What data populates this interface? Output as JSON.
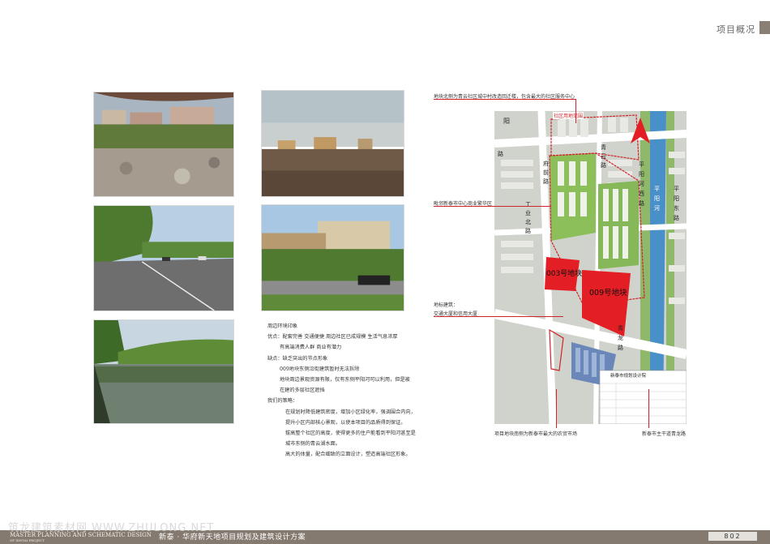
{
  "header": {
    "label": "项目概况"
  },
  "photos": [
    {
      "name": "photo-construction-site"
    },
    {
      "name": "photo-vacant-lot"
    },
    {
      "name": "photo-tree-lined-road"
    },
    {
      "name": "photo-commercial-street"
    },
    {
      "name": "photo-canal"
    }
  ],
  "notes": {
    "title": "周边环境印象",
    "lines": [
      "优点：配套完善  交通便捷  周边社区已成规模  生活气息浓厚",
      "有高端消费人群    商业有潜力",
      "缺点：缺乏突出的节点形象",
      "009地块东侧沿街建筑暂时无法拆除",
      "地块周边景观资源有限，仅有东侧平阳河可以利用，但是被",
      "在建的多层社区遮挡",
      "我们的策略：",
      "在规划时降低建筑密度，增加小区绿化率，强调围合内向，",
      "提升小区内部核心景观，以使本项目的品质得到保证。",
      "拔高整个社区的高度，使得更多的住户能看到平阳河甚至是",
      "城市东侧的青云湖水面。",
      "高大的体量，配合细致的立面设计，塑造高端社区形象。"
    ]
  },
  "map": {
    "callouts": {
      "north": "地块北侧为青云社区城中村改造回迁楼，包含最大的社区服务中心",
      "west": "毗邻新泰市中心商业繁华区",
      "landmark_title": "地标建筑：",
      "landmark_value": "交通大厦和信用大厦",
      "south": "项目地块南侧为新泰市最大的农贸市场",
      "southeast": "新泰市主干道青龙路"
    },
    "plots": {
      "plot_003": "003号地块",
      "plot_009": "009号地块"
    },
    "plot_label_top": "社区用地范围",
    "roads": {
      "qingyun_road": [
        "青",
        "云",
        "路"
      ],
      "pingyang_west": [
        "平",
        "阳",
        "河",
        "西",
        "路"
      ],
      "pingyang_east": [
        "平",
        "阳",
        "东",
        "路"
      ],
      "pingyang_river": [
        "平",
        "阳",
        "河"
      ],
      "yang": [
        "阳"
      ],
      "road_w": [
        "路"
      ],
      "fuyang_road": [
        "府",
        "前",
        "路"
      ],
      "qinglong_road": [
        "青",
        "龙",
        "路"
      ],
      "industry_road": [
        "工",
        "业",
        "北",
        "路"
      ]
    },
    "title_block": "新泰市规划设计院"
  },
  "footer": {
    "watermark": "筑龙建筑素材网  WWW.ZHULONG.NET",
    "logo_line1": "MASTER PLANNING AND SCHEMATIC DESIGN",
    "logo_line2": "OF XINTAI PROJECT",
    "title": "新泰 · 华府新天地项目规划及建筑设计方案",
    "page": "802"
  },
  "colors": {
    "footer": "#847a70",
    "plot_red": "#e31e24",
    "callout_line": "#d0232a",
    "river": "#4a90c8"
  }
}
